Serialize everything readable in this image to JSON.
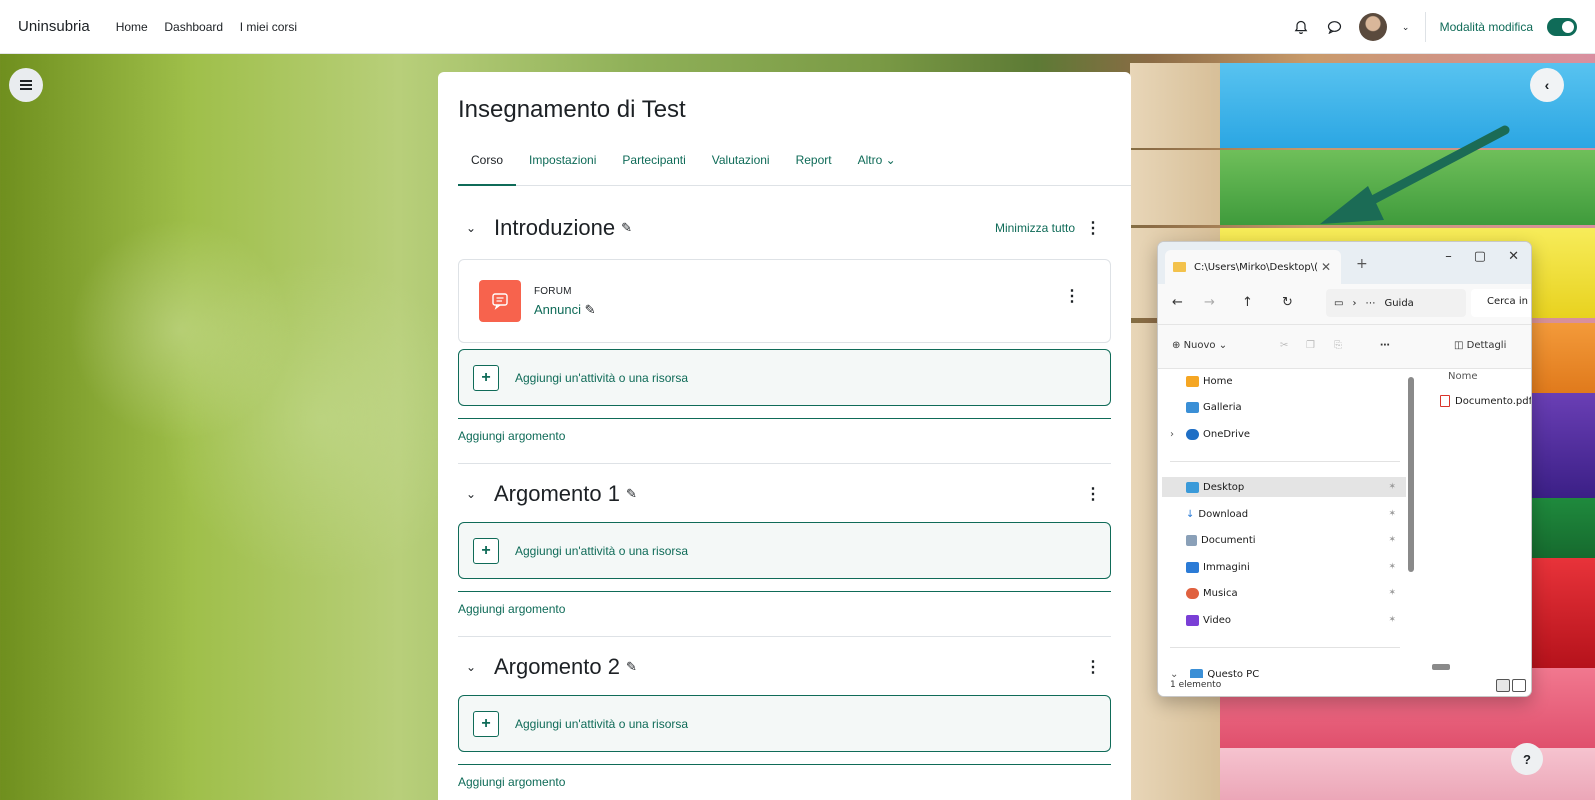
{
  "topbar": {
    "brand": "Uninsubria",
    "nav": [
      "Home",
      "Dashboard",
      "I miei corsi"
    ],
    "edit_mode_label": "Modalità modifica",
    "edit_mode_on": true
  },
  "course": {
    "title": "Insegnamento di Test",
    "tabs": [
      "Corso",
      "Impostazioni",
      "Partecipanti",
      "Valutazioni",
      "Report",
      "Altro ⌄"
    ],
    "active_tab": "Corso",
    "collapse_all": "Minimizza tutto",
    "sections": [
      {
        "title": "Introduzione",
        "activities": [
          {
            "type": "FORUM",
            "name": "Annunci"
          }
        ],
        "add_activity": "Aggiungi un'attività o una risorsa",
        "add_topic": "Aggiungi argomento"
      },
      {
        "title": "Argomento 1",
        "add_activity": "Aggiungi un'attività o una risorsa",
        "add_topic": "Aggiungi argomento"
      },
      {
        "title": "Argomento 2",
        "add_activity": "Aggiungi un'attività o una risorsa",
        "add_topic": "Aggiungi argomento"
      }
    ]
  },
  "help": "?",
  "explorer": {
    "tab_path": "C:\\Users\\Mirko\\Desktop\\(",
    "address_tail": "Guida",
    "search_placeholder": "Cerca in",
    "new_label": "Nuovo",
    "details_label": "Dettagli",
    "nav_items": [
      {
        "label": "Home",
        "icon": "home-icon",
        "color": "#f5a623"
      },
      {
        "label": "Galleria",
        "icon": "gallery-icon",
        "color": "#3a8fd6"
      },
      {
        "label": "OneDrive",
        "icon": "cloud-icon",
        "color": "#1f6fc5"
      },
      {
        "label": "Desktop",
        "icon": "desktop-icon",
        "color": "#3a9ad9"
      },
      {
        "label": "Download",
        "icon": "download-icon",
        "color": "#2b7bd6"
      },
      {
        "label": "Documenti",
        "icon": "documents-icon",
        "color": "#8aa0b8"
      },
      {
        "label": "Immagini",
        "icon": "pictures-icon",
        "color": "#2b7bd6"
      },
      {
        "label": "Musica",
        "icon": "music-icon",
        "color": "#e0613f"
      },
      {
        "label": "Video",
        "icon": "video-icon",
        "color": "#7a3fd6"
      },
      {
        "label": "Questo PC",
        "icon": "pc-icon",
        "color": "#3a8fd6"
      }
    ],
    "column_header": "Nome",
    "files": [
      "Documento.pdf"
    ],
    "status": "1 elemento"
  }
}
